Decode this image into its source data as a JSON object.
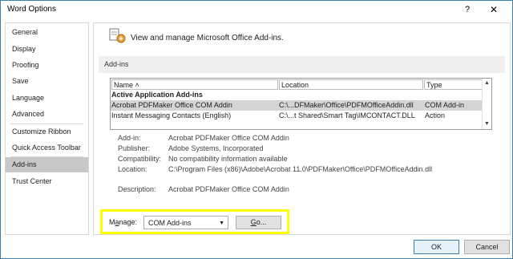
{
  "window": {
    "title": "Word Options",
    "help_glyph": "?",
    "close_glyph": "✕"
  },
  "sidebar": {
    "items": [
      {
        "label": "General"
      },
      {
        "label": "Display"
      },
      {
        "label": "Proofing"
      },
      {
        "label": "Save"
      },
      {
        "label": "Language"
      },
      {
        "label": "Advanced"
      },
      {
        "label": "Customize Ribbon"
      },
      {
        "label": "Quick Access Toolbar"
      },
      {
        "label": "Add-ins"
      },
      {
        "label": "Trust Center"
      }
    ],
    "active": "Add-ins"
  },
  "main": {
    "header_text": "View and manage Microsoft Office Add-ins.",
    "section_title": "Add-ins",
    "columns": {
      "name": "Name ˄",
      "location": "Location",
      "type": "Type"
    },
    "group_header": "Active Application Add-ins",
    "rows": [
      {
        "name": "Acrobat PDFMaker Office COM Addin",
        "location": "C:\\...DFMaker\\Office\\PDFMOfficeAddin.dll",
        "type": "COM Add-in"
      },
      {
        "name": "Instant Messaging Contacts (English)",
        "location": "C:\\...t Shared\\Smart Tag\\IMCONTACT.DLL",
        "type": "Action"
      }
    ],
    "details": {
      "addin_label": "Add-in:",
      "addin_value": "Acrobat PDFMaker Office COM Addin",
      "publisher_label": "Publisher:",
      "publisher_value": "Adobe Systems, Incorporated",
      "compat_label": "Compatibility:",
      "compat_value": "No compatibility information available",
      "location_label": "Location:",
      "location_value": "C:\\Program Files (x86)\\Adobe\\Acrobat 11.0\\PDFMaker\\Office\\PDFMOfficeAddin.dll",
      "description_label": "Description:",
      "description_value": "Acrobat PDFMaker Office COM Addin"
    },
    "manage": {
      "label_prefix": "M",
      "label_ul": "a",
      "label_suffix": "nage:",
      "selected": "COM Add-ins",
      "go_ul": "G",
      "go_suffix": "o..."
    }
  },
  "footer": {
    "ok": "OK",
    "cancel": "Cancel"
  },
  "colors": {
    "highlight": "#ffff00",
    "accent_border": "#3c7fb1"
  }
}
